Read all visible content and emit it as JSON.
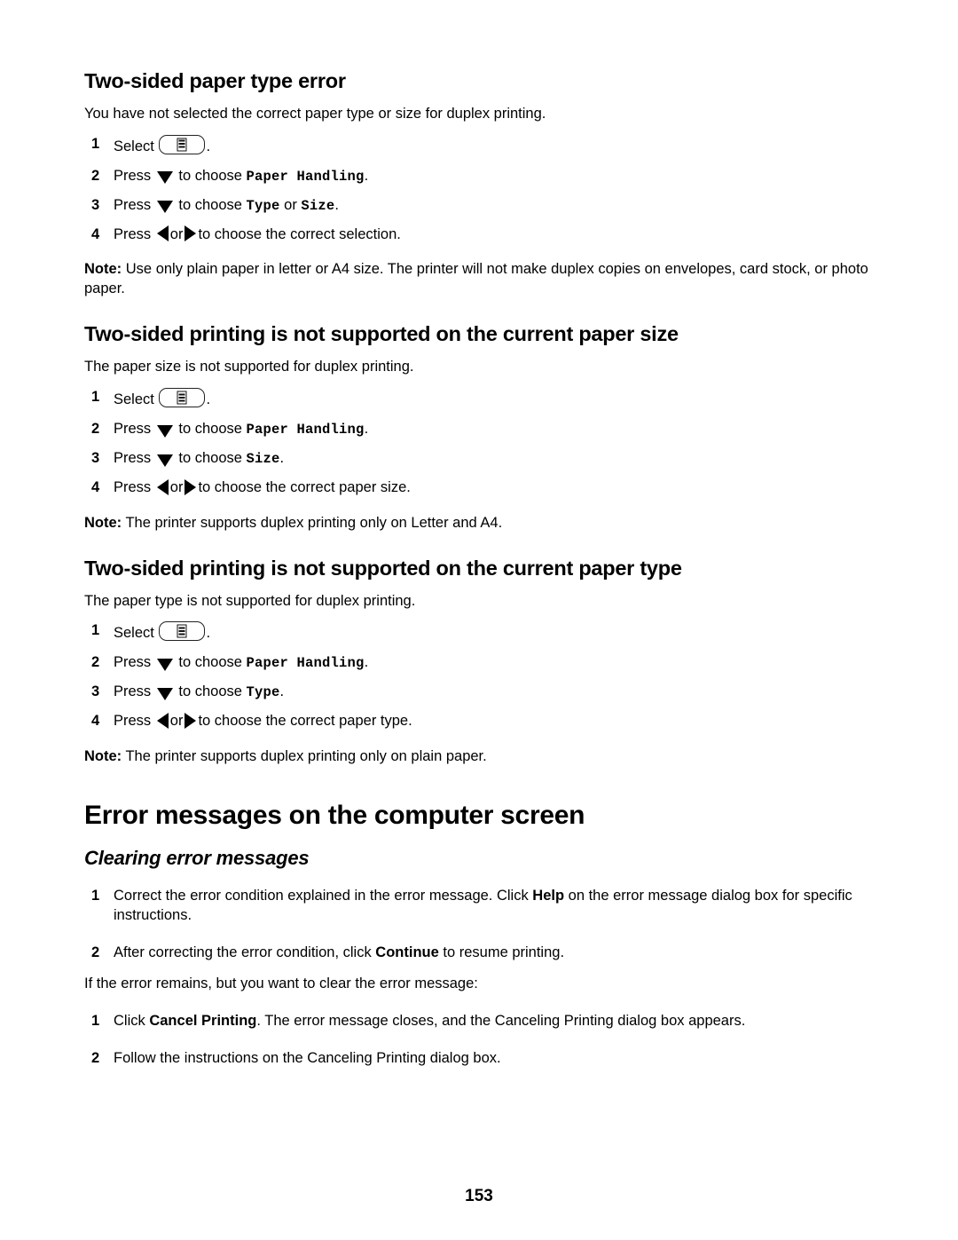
{
  "document": {
    "page_number": "153"
  },
  "sections": [
    {
      "heading": "Two-sided paper type error",
      "intro": "You have not selected the correct paper type or size for duplex printing.",
      "steps": [
        {
          "num": "1",
          "pre": "Select",
          "post": "."
        },
        {
          "num": "2",
          "pre": "Press",
          "mid": "to choose",
          "menu": "Paper Handling",
          "post": "."
        },
        {
          "num": "3",
          "pre": "Press",
          "mid": "to choose",
          "menu": "Type",
          "conj": "or",
          "menu2": "Size",
          "post": "."
        },
        {
          "num": "4",
          "pre": "Press",
          "conj": "or",
          "post": "to choose the correct selection."
        }
      ],
      "note_label": "Note:",
      "note_text": "Use only plain paper in letter or A4 size. The printer will not make duplex copies on envelopes, card stock, or photo paper."
    },
    {
      "heading": "Two-sided printing is not supported on the current paper size",
      "intro": "The paper size is not supported for duplex printing.",
      "steps": [
        {
          "num": "1",
          "pre": "Select",
          "post": "."
        },
        {
          "num": "2",
          "pre": "Press",
          "mid": "to choose",
          "menu": "Paper Handling",
          "post": "."
        },
        {
          "num": "3",
          "pre": "Press",
          "mid": "to choose",
          "menu": "Size",
          "post": "."
        },
        {
          "num": "4",
          "pre": "Press",
          "conj": "or",
          "post": "to choose the correct paper size."
        }
      ],
      "note_label": "Note:",
      "note_text": "The printer supports duplex printing only on Letter and A4."
    },
    {
      "heading": "Two-sided printing is not supported on the current paper type",
      "intro": "The paper type is not supported for duplex printing.",
      "steps": [
        {
          "num": "1",
          "pre": "Select",
          "post": "."
        },
        {
          "num": "2",
          "pre": "Press",
          "mid": "to choose",
          "menu": "Paper Handling",
          "post": "."
        },
        {
          "num": "3",
          "pre": "Press",
          "mid": "to choose",
          "menu": "Type",
          "post": "."
        },
        {
          "num": "4",
          "pre": "Press",
          "conj": "or",
          "post": "to choose the correct paper type."
        }
      ],
      "note_label": "Note:",
      "note_text": "The printer supports duplex printing only on plain paper."
    }
  ],
  "error_messages": {
    "heading": "Error messages on the computer screen",
    "subheading": "Clearing error messages",
    "steps_primary": [
      {
        "num": "1",
        "part1": "Correct the error condition explained in the error message. Click ",
        "bold": "Help",
        "part2": " on the error message dialog box for specific instructions."
      },
      {
        "num": "2",
        "part1": "After correcting the error condition, click ",
        "bold": "Continue",
        "part2": " to resume printing."
      }
    ],
    "bridge_text": "If the error remains, but you want to clear the error message:",
    "steps_secondary": [
      {
        "num": "1",
        "part1": "Click ",
        "bold": "Cancel Printing",
        "part2": ". The error message closes, and the Canceling Printing dialog box appears."
      },
      {
        "num": "2",
        "part1": "Follow the instructions on the Canceling Printing dialog box.",
        "bold": "",
        "part2": ""
      }
    ]
  }
}
